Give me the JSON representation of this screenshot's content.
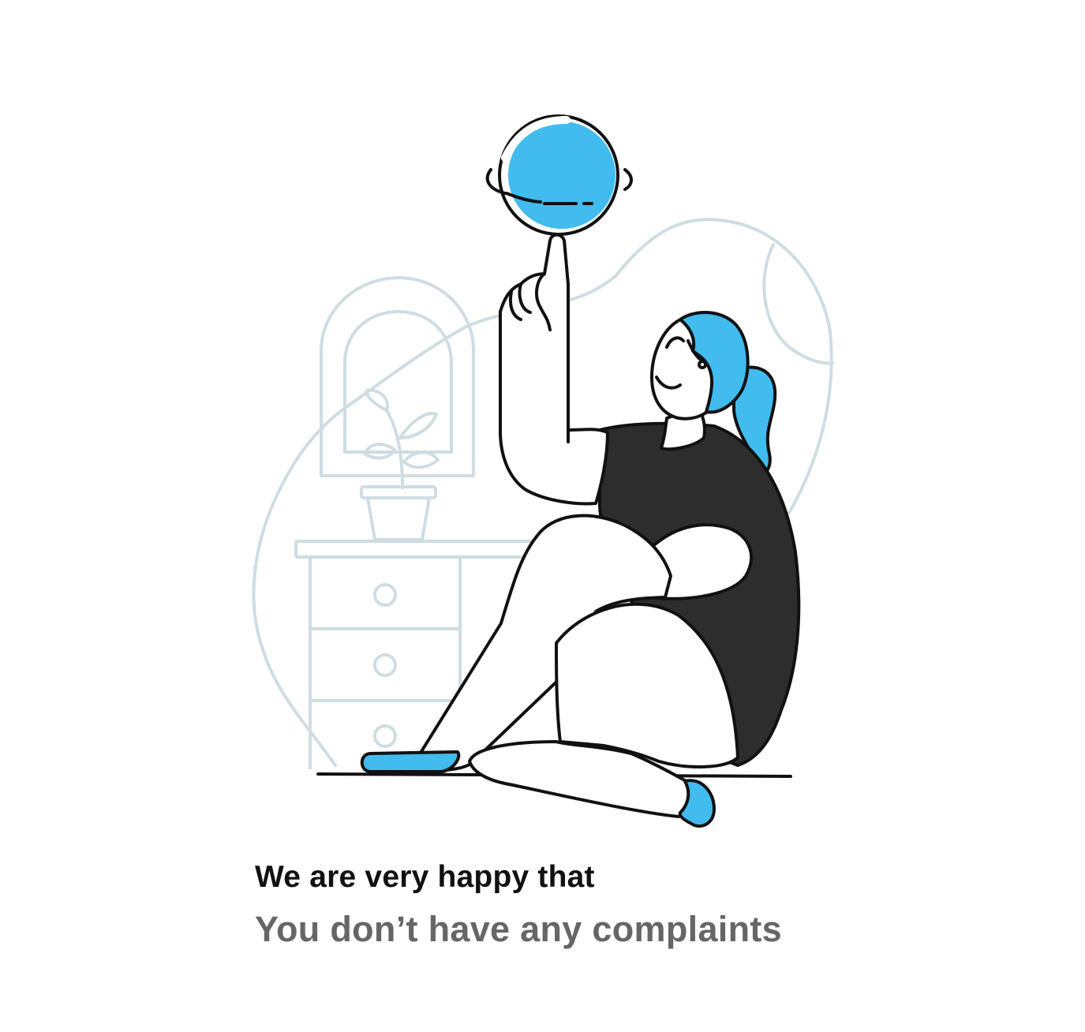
{
  "message": {
    "title": "We are very happy that",
    "subtitle": "You don’t have any complaints"
  },
  "colors": {
    "accent": "#42BBEF",
    "ink": "#111111",
    "shirt": "#2D2D2D",
    "background_lines": "#CFDDE2",
    "title_text": "#111111",
    "subtitle_text": "#666666"
  },
  "illustration": {
    "icon": "person-spinning-ball-illustration"
  }
}
